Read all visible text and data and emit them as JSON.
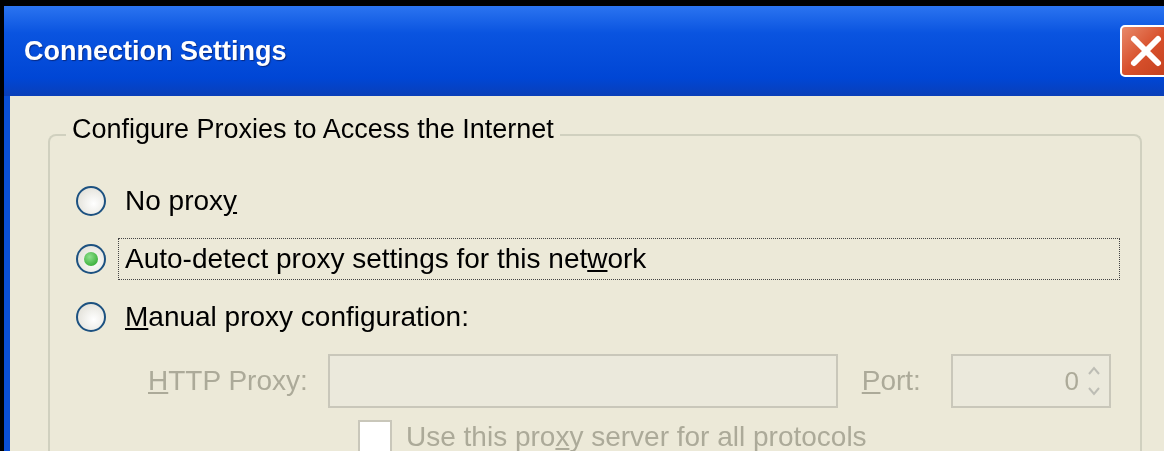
{
  "window": {
    "title": "Connection Settings"
  },
  "group": {
    "legend": "Configure Proxies to Access the Internet",
    "options": [
      {
        "label": {
          "pre": "No prox",
          "key": "y"
        },
        "selected": false,
        "focused": false
      },
      {
        "label": {
          "pre": "Auto-detect proxy settings for this net",
          "key": "w",
          "post": "ork"
        },
        "selected": true,
        "focused": true
      },
      {
        "label": {
          "key": "M",
          "post": "anual proxy configuration:"
        },
        "selected": false,
        "focused": false
      }
    ],
    "http_proxy": {
      "label": {
        "key": "H",
        "post": "TTP Proxy:"
      },
      "disabled": true
    },
    "port": {
      "label": {
        "key": "P",
        "post": "ort:"
      },
      "value": "0",
      "disabled": true
    },
    "all_protocols": {
      "label": {
        "pre": "Use this pro",
        "key": "x",
        "post": "y server for all protocols"
      },
      "checked": false,
      "disabled": true
    }
  }
}
